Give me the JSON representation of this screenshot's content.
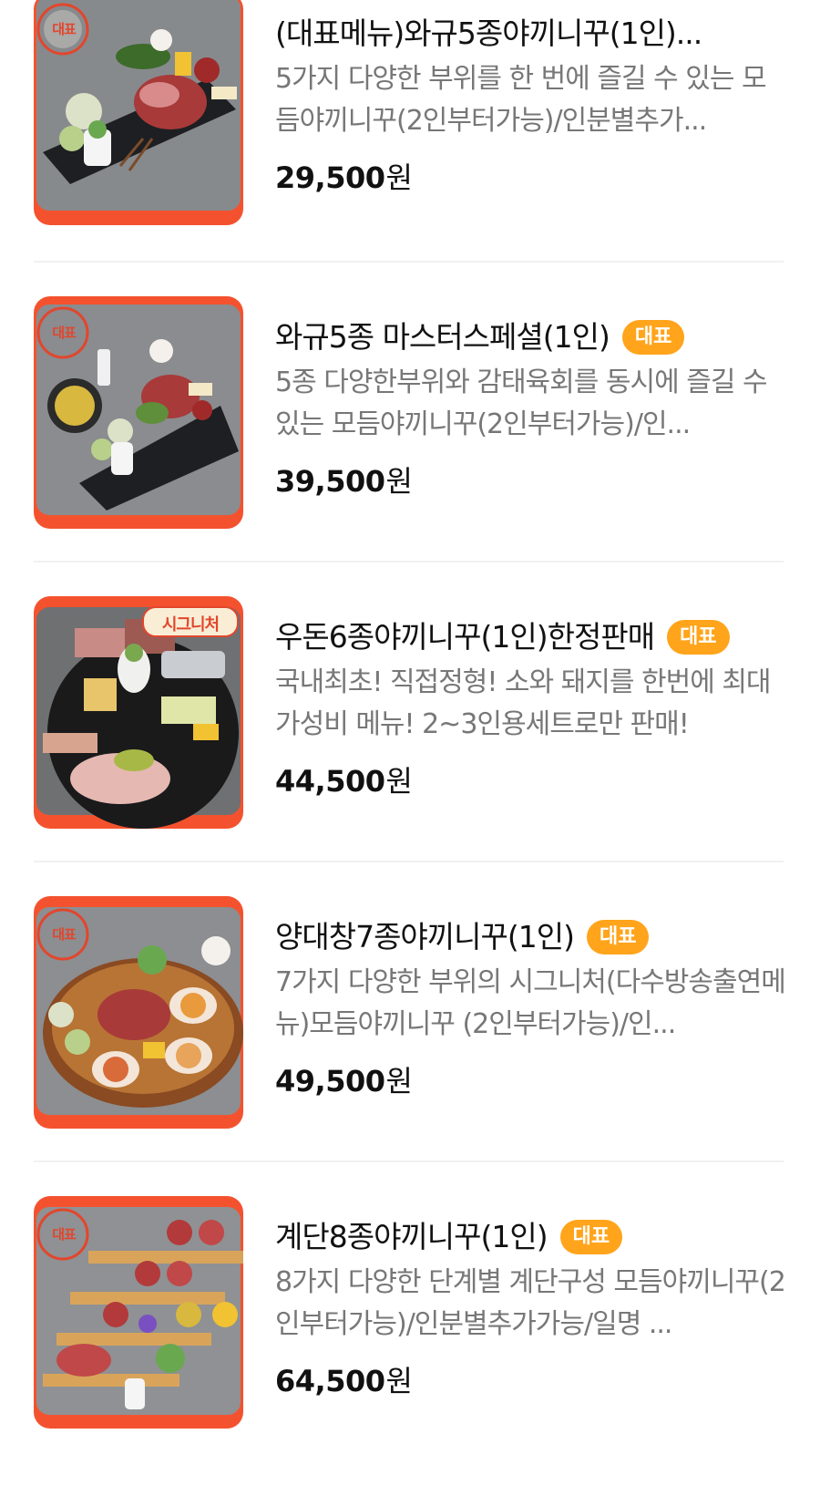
{
  "menu_items": [
    {
      "title": "(대표메뉴)와규5종야끼니꾸(1인)...",
      "badge": "",
      "description": "5가지 다양한 부위를 한 번에 즐길 수 있는 모듬야끼니꾸(2인부터가능)/인분별추가...",
      "price": "29,500",
      "currency": "원",
      "stamp_text": "대표",
      "image_style": "slate-platter"
    },
    {
      "title": "와규5종 마스터스페셜(1인)",
      "badge": "대표",
      "description": "5종 다양한부위와 감태육회를 동시에 즐길 수 있는 모듬야끼니꾸(2인부터가능)/인...",
      "price": "39,500",
      "currency": "원",
      "stamp_text": "대표",
      "image_style": "slate-platter"
    },
    {
      "title": "우돈6종야끼니꾸(1인)한정판매",
      "badge": "대표",
      "description": "국내최초! 직접정형! 소와 돼지를 한번에 최대 가성비 메뉴! 2~3인용세트로만 판매!",
      "price": "44,500",
      "currency": "원",
      "stamp_text": "시그니처",
      "image_style": "dark-round-platter"
    },
    {
      "title": "양대창7종야끼니꾸(1인)",
      "badge": "대표",
      "description": "7가지 다양한 부위의 시그니처(다수방송출연메뉴)모듬야끼니꾸 (2인부터가능)/인...",
      "price": "49,500",
      "currency": "원",
      "stamp_text": "대표",
      "image_style": "wood-round-platter"
    },
    {
      "title": "계단8종야끼니꾸(1인)",
      "badge": "대표",
      "description": "8가지 다양한 단계별 계단구성 모듬야끼니꾸(2인부터가능)/인분별추가가능/일명 ...",
      "price": "64,500",
      "currency": "원",
      "stamp_text": "대표",
      "image_style": "wooden-stairs"
    }
  ],
  "colors": {
    "accent": "#f4522f",
    "badge_bg": "#ffa41b",
    "description": "#777777",
    "divider": "#f1f1f1"
  }
}
